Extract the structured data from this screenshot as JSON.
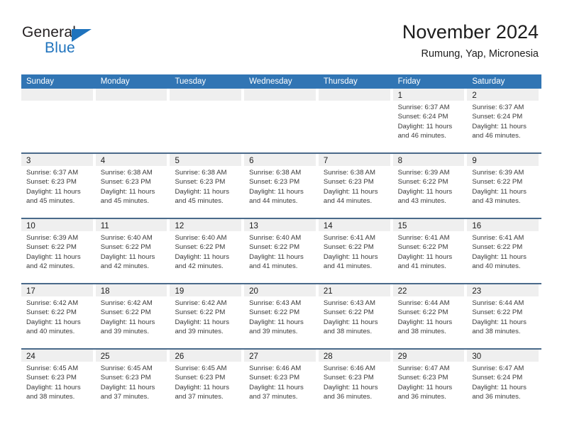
{
  "brand": {
    "name_part1": "General",
    "name_part2": "Blue",
    "accent_color": "#1f73bd"
  },
  "header": {
    "title": "November 2024",
    "subtitle": "Rumung, Yap, Micronesia"
  },
  "theme": {
    "header_blue": "#3175b4",
    "row_separator": "#4a6a8a",
    "day_band_gray": "#efefef"
  },
  "weekdays": [
    "Sunday",
    "Monday",
    "Tuesday",
    "Wednesday",
    "Thursday",
    "Friday",
    "Saturday"
  ],
  "weeks": [
    [
      {
        "day": "",
        "empty": true
      },
      {
        "day": "",
        "empty": true
      },
      {
        "day": "",
        "empty": true
      },
      {
        "day": "",
        "empty": true
      },
      {
        "day": "",
        "empty": true
      },
      {
        "day": "1",
        "sunrise": "Sunrise: 6:37 AM",
        "sunset": "Sunset: 6:24 PM",
        "daylight": "Daylight: 11 hours and 46 minutes."
      },
      {
        "day": "2",
        "sunrise": "Sunrise: 6:37 AM",
        "sunset": "Sunset: 6:24 PM",
        "daylight": "Daylight: 11 hours and 46 minutes."
      }
    ],
    [
      {
        "day": "3",
        "sunrise": "Sunrise: 6:37 AM",
        "sunset": "Sunset: 6:23 PM",
        "daylight": "Daylight: 11 hours and 45 minutes."
      },
      {
        "day": "4",
        "sunrise": "Sunrise: 6:38 AM",
        "sunset": "Sunset: 6:23 PM",
        "daylight": "Daylight: 11 hours and 45 minutes."
      },
      {
        "day": "5",
        "sunrise": "Sunrise: 6:38 AM",
        "sunset": "Sunset: 6:23 PM",
        "daylight": "Daylight: 11 hours and 45 minutes."
      },
      {
        "day": "6",
        "sunrise": "Sunrise: 6:38 AM",
        "sunset": "Sunset: 6:23 PM",
        "daylight": "Daylight: 11 hours and 44 minutes."
      },
      {
        "day": "7",
        "sunrise": "Sunrise: 6:38 AM",
        "sunset": "Sunset: 6:23 PM",
        "daylight": "Daylight: 11 hours and 44 minutes."
      },
      {
        "day": "8",
        "sunrise": "Sunrise: 6:39 AM",
        "sunset": "Sunset: 6:22 PM",
        "daylight": "Daylight: 11 hours and 43 minutes."
      },
      {
        "day": "9",
        "sunrise": "Sunrise: 6:39 AM",
        "sunset": "Sunset: 6:22 PM",
        "daylight": "Daylight: 11 hours and 43 minutes."
      }
    ],
    [
      {
        "day": "10",
        "sunrise": "Sunrise: 6:39 AM",
        "sunset": "Sunset: 6:22 PM",
        "daylight": "Daylight: 11 hours and 42 minutes."
      },
      {
        "day": "11",
        "sunrise": "Sunrise: 6:40 AM",
        "sunset": "Sunset: 6:22 PM",
        "daylight": "Daylight: 11 hours and 42 minutes."
      },
      {
        "day": "12",
        "sunrise": "Sunrise: 6:40 AM",
        "sunset": "Sunset: 6:22 PM",
        "daylight": "Daylight: 11 hours and 42 minutes."
      },
      {
        "day": "13",
        "sunrise": "Sunrise: 6:40 AM",
        "sunset": "Sunset: 6:22 PM",
        "daylight": "Daylight: 11 hours and 41 minutes."
      },
      {
        "day": "14",
        "sunrise": "Sunrise: 6:41 AM",
        "sunset": "Sunset: 6:22 PM",
        "daylight": "Daylight: 11 hours and 41 minutes."
      },
      {
        "day": "15",
        "sunrise": "Sunrise: 6:41 AM",
        "sunset": "Sunset: 6:22 PM",
        "daylight": "Daylight: 11 hours and 41 minutes."
      },
      {
        "day": "16",
        "sunrise": "Sunrise: 6:41 AM",
        "sunset": "Sunset: 6:22 PM",
        "daylight": "Daylight: 11 hours and 40 minutes."
      }
    ],
    [
      {
        "day": "17",
        "sunrise": "Sunrise: 6:42 AM",
        "sunset": "Sunset: 6:22 PM",
        "daylight": "Daylight: 11 hours and 40 minutes."
      },
      {
        "day": "18",
        "sunrise": "Sunrise: 6:42 AM",
        "sunset": "Sunset: 6:22 PM",
        "daylight": "Daylight: 11 hours and 39 minutes."
      },
      {
        "day": "19",
        "sunrise": "Sunrise: 6:42 AM",
        "sunset": "Sunset: 6:22 PM",
        "daylight": "Daylight: 11 hours and 39 minutes."
      },
      {
        "day": "20",
        "sunrise": "Sunrise: 6:43 AM",
        "sunset": "Sunset: 6:22 PM",
        "daylight": "Daylight: 11 hours and 39 minutes."
      },
      {
        "day": "21",
        "sunrise": "Sunrise: 6:43 AM",
        "sunset": "Sunset: 6:22 PM",
        "daylight": "Daylight: 11 hours and 38 minutes."
      },
      {
        "day": "22",
        "sunrise": "Sunrise: 6:44 AM",
        "sunset": "Sunset: 6:22 PM",
        "daylight": "Daylight: 11 hours and 38 minutes."
      },
      {
        "day": "23",
        "sunrise": "Sunrise: 6:44 AM",
        "sunset": "Sunset: 6:22 PM",
        "daylight": "Daylight: 11 hours and 38 minutes."
      }
    ],
    [
      {
        "day": "24",
        "sunrise": "Sunrise: 6:45 AM",
        "sunset": "Sunset: 6:23 PM",
        "daylight": "Daylight: 11 hours and 38 minutes."
      },
      {
        "day": "25",
        "sunrise": "Sunrise: 6:45 AM",
        "sunset": "Sunset: 6:23 PM",
        "daylight": "Daylight: 11 hours and 37 minutes."
      },
      {
        "day": "26",
        "sunrise": "Sunrise: 6:45 AM",
        "sunset": "Sunset: 6:23 PM",
        "daylight": "Daylight: 11 hours and 37 minutes."
      },
      {
        "day": "27",
        "sunrise": "Sunrise: 6:46 AM",
        "sunset": "Sunset: 6:23 PM",
        "daylight": "Daylight: 11 hours and 37 minutes."
      },
      {
        "day": "28",
        "sunrise": "Sunrise: 6:46 AM",
        "sunset": "Sunset: 6:23 PM",
        "daylight": "Daylight: 11 hours and 36 minutes."
      },
      {
        "day": "29",
        "sunrise": "Sunrise: 6:47 AM",
        "sunset": "Sunset: 6:23 PM",
        "daylight": "Daylight: 11 hours and 36 minutes."
      },
      {
        "day": "30",
        "sunrise": "Sunrise: 6:47 AM",
        "sunset": "Sunset: 6:24 PM",
        "daylight": "Daylight: 11 hours and 36 minutes."
      }
    ]
  ]
}
